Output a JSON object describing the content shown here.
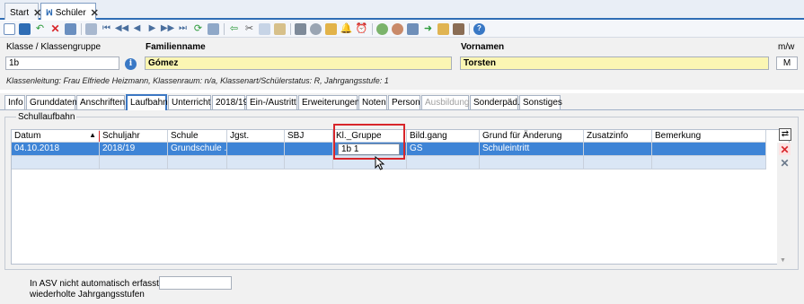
{
  "doc_tabs": [
    {
      "label": "Start",
      "close": "✕"
    },
    {
      "label": "Schüler",
      "close": "✕"
    }
  ],
  "toolbar_icons": [
    "new-icon",
    "save-icon",
    "undo-icon",
    "delete-icon",
    "import-icon",
    "list-icon",
    "first-icon",
    "prev-page-icon",
    "prev-icon",
    "next-icon",
    "next-page-icon",
    "last-icon",
    "refresh-icon",
    "grid-icon",
    "back-arrow-icon",
    "cut-icon",
    "copy-icon",
    "paste-icon",
    "print-icon",
    "preview-icon",
    "export-icon",
    "bell-icon",
    "alarm-icon",
    "settings-icon",
    "person-icon",
    "table-icon",
    "forward-icon",
    "export-doc-icon",
    "contact-icon",
    "help-icon"
  ],
  "header": {
    "class_label": "Klasse / Klassengruppe",
    "class_value": "1b",
    "lastname_label": "Familienname",
    "lastname_value": "Gómez",
    "firstname_label": "Vornamen",
    "firstname_value": "Torsten",
    "gender_label": "m/w",
    "gender_value": "M",
    "info_icon": "i",
    "class_info": "Klassenleitung: Frau Elfriede Heizmann, Klassenraum: n/a, Klassenart/Schülerstatus: R, Jahrgangsstufe: 1"
  },
  "tabs": [
    {
      "label": "Info"
    },
    {
      "label": "Grunddaten"
    },
    {
      "label": "Anschriften"
    },
    {
      "label": "Laufbahn"
    },
    {
      "label": "Unterricht"
    },
    {
      "label": "2018/19"
    },
    {
      "label": "Ein-/Austritt"
    },
    {
      "label": "Erweiterungen"
    },
    {
      "label": "Noten"
    },
    {
      "label": "Person"
    },
    {
      "label": "Ausbildung"
    },
    {
      "label": "Sonderpäd."
    },
    {
      "label": "Sonstiges"
    }
  ],
  "section": {
    "title": "Schullaufbahn",
    "columns": [
      "Datum",
      "Schuljahr",
      "Schule",
      "Jgst.",
      "SBJ",
      "Kl._Gruppe",
      "Bild.gang",
      "Grund für Änderung",
      "Zusatzinfo",
      "Bemerkung"
    ],
    "rows": [
      {
        "datum": "04.10.2018",
        "schuljahr": "2018/19",
        "schule": "Grundschule ...",
        "jgst": "",
        "sbj": "",
        "kl_gruppe": "1b 1",
        "bildgang": "GS",
        "grund": "Schuleintritt",
        "zusatz": "",
        "bemerkung": ""
      },
      {
        "datum": "",
        "schuljahr": "",
        "schule": "",
        "jgst": "",
        "sbj": "",
        "kl_gruppe": "",
        "bildgang": "",
        "grund": "",
        "zusatz": "",
        "bemerkung": ""
      }
    ]
  },
  "footer": {
    "label_line1": "In ASV nicht automatisch erfasste",
    "label_line2": "wiederholte Jahrgangsstufen",
    "input_value": ""
  },
  "colors": {
    "accent": "#2f6db5",
    "selection": "#3e84d6",
    "highlight": "#d8262b",
    "name_field": "#fbf6b3"
  }
}
